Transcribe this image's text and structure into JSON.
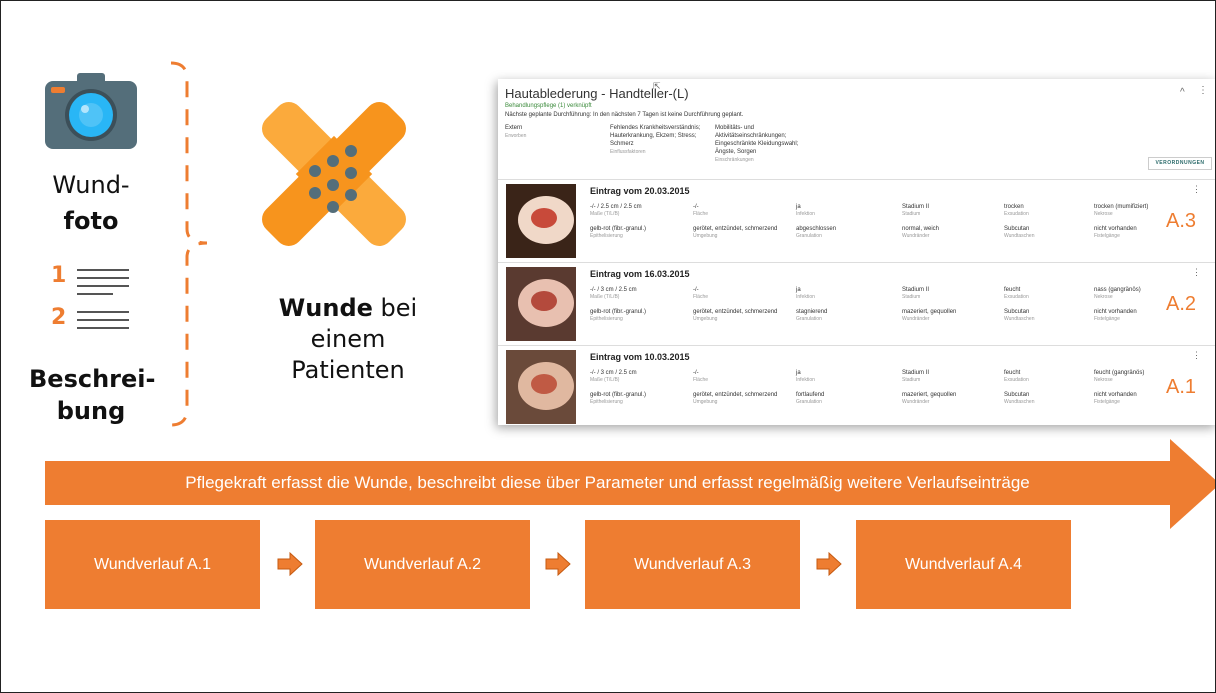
{
  "left": {
    "photo_label_1": "Wund-",
    "photo_label_2": "foto",
    "list_num_1": "1",
    "list_num_2": "2",
    "desc_label_1": "Beschrei-",
    "desc_label_2": "bung"
  },
  "middle": {
    "wound_bold": "Wunde",
    "wound_rest": " bei",
    "line2": "einem",
    "line3": "Patienten"
  },
  "panel": {
    "title": "Hautablederung - Handteller-(L)",
    "linked": "Behandlungspflege (1) verknüpft",
    "next_planned": "Nächste geplante Durchführung: In den nächsten 7 Tagen ist keine Durchführung geplant.",
    "ext_value": "Extern",
    "ext_label": "Erworben",
    "influence_value": "Fehlendes Krankheitsverständnis; Hauterkrankung, Ekzem; Stress; Schmerz",
    "influence_label": "Einflussfaktoren",
    "restriction_value": "Mobilitäts- und Aktivitätseinschränkungen; Eingeschränkte Kleidungswahl; Ängste, Sorgen",
    "restriction_label": "Einschränkungen",
    "orders_button": "VERORDNUNGEN",
    "collapse_icon": "^",
    "entries": [
      {
        "title": "Eintrag vom 20.03.2015",
        "badge": "A.3",
        "r1": [
          [
            "-/- / 2.5 cm / 2.5 cm",
            "Maße (T/L/B)"
          ],
          [
            "-/-",
            "Fläche"
          ],
          [
            "ja",
            "Infektion"
          ],
          [
            "Stadium II",
            "Stadium"
          ],
          [
            "trocken",
            "Exsudation"
          ],
          [
            "trocken (mumifiziert)",
            "Nekrose"
          ]
        ],
        "r2": [
          [
            "gelb-rot (fibr.-granul.)",
            "Epithelisierung"
          ],
          [
            "gerötet, entzündet, schmerzend",
            "Umgebung"
          ],
          [
            "abgeschlossen",
            "Granulation"
          ],
          [
            "normal, weich",
            "Wundränder"
          ],
          [
            "Subcutan",
            "Wundtaschen"
          ],
          [
            "nicht vorhanden",
            "Fistelgänge"
          ]
        ]
      },
      {
        "title": "Eintrag vom 16.03.2015",
        "badge": "A.2",
        "r1": [
          [
            "-/- / 3 cm / 2.5 cm",
            "Maße (T/L/B)"
          ],
          [
            "-/-",
            "Fläche"
          ],
          [
            "ja",
            "Infektion"
          ],
          [
            "Stadium II",
            "Stadium"
          ],
          [
            "feucht",
            "Exsudation"
          ],
          [
            "nass (gangränös)",
            "Nekrose"
          ]
        ],
        "r2": [
          [
            "gelb-rot (fibr.-granul.)",
            "Epithelisierung"
          ],
          [
            "gerötet, entzündet, schmerzend",
            "Umgebung"
          ],
          [
            "stagnierend",
            "Granulation"
          ],
          [
            "mazeriert, gequollen",
            "Wundränder"
          ],
          [
            "Subcutan",
            "Wundtaschen"
          ],
          [
            "nicht vorhanden",
            "Fistelgänge"
          ]
        ]
      },
      {
        "title": "Eintrag vom 10.03.2015",
        "badge": "A.1",
        "r1": [
          [
            "-/- / 3 cm / 2.5 cm",
            "Maße (T/L/B)"
          ],
          [
            "-/-",
            "Fläche"
          ],
          [
            "ja",
            "Infektion"
          ],
          [
            "Stadium II",
            "Stadium"
          ],
          [
            "feucht",
            "Exsudation"
          ],
          [
            "feucht (gangränös)",
            "Nekrose"
          ]
        ],
        "r2": [
          [
            "gelb-rot (fibr.-granul.)",
            "Epithelisierung"
          ],
          [
            "gerötet, entzündet, schmerzend",
            "Umgebung"
          ],
          [
            "fortlaufend",
            "Granulation"
          ],
          [
            "mazeriert, gequollen",
            "Wundränder"
          ],
          [
            "Subcutan",
            "Wundtaschen"
          ],
          [
            "nicht vorhanden",
            "Fistelgänge"
          ]
        ]
      }
    ]
  },
  "banner": "Pflegekraft erfasst die Wunde, beschreibt diese über Parameter und erfasst regelmäßig weitere Verlaufseinträge",
  "steps": [
    "Wundverlauf A.1",
    "Wundverlauf A.2",
    "Wundverlauf A.3",
    "Wundverlauf A.4"
  ],
  "colors": {
    "accent": "#ee7d31",
    "text": "#111111"
  },
  "icons": [
    "camera-icon",
    "numbered-list-icon",
    "bandage-icon",
    "chevron-up-icon",
    "more-vert-icon",
    "arrow-right-icon"
  ]
}
